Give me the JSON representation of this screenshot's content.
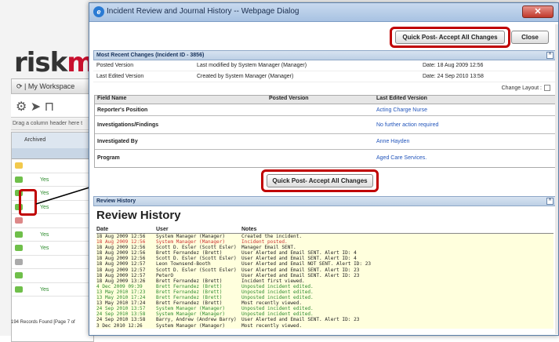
{
  "background_app": {
    "logo_text": "risk",
    "logo_text_accent": "ma",
    "nav_tab_label": "My Workspace",
    "drag_hint": "Drag a column header here t",
    "grid_header_label": "Archived",
    "row_values": [
      "",
      "Yes",
      "Yes",
      "Yes",
      "",
      "Yes",
      "Yes",
      "",
      "",
      "Yes"
    ],
    "records_found": "194 Records Found [Page 7 of"
  },
  "dialog": {
    "title": "Incident Review and Journal History -- Webpage Dialog",
    "quick_post_top_label": "Quick Post- Accept All Changes",
    "close_label": "Close",
    "recent_changes": {
      "section_title": "Most Recent Changes (Incident ID - 3856)",
      "versions": [
        {
          "label": "Posted Version",
          "modified": "Last modified by System Manager (Manager)",
          "date": "Date: 18 Aug 2009 12:56"
        },
        {
          "label": "Last Edited Version",
          "modified": "Created by System Manager (Manager)",
          "date": "Date: 24 Sep 2010 13:58"
        }
      ],
      "change_layout_label": "Change Layout :",
      "columns": [
        "Field Name",
        "Posted Version",
        "Last Edited Version"
      ],
      "fields": [
        {
          "name": "Reporter's Position",
          "posted": "",
          "edited": "Acting Charge Nurse"
        },
        {
          "name": "Investigations/Findings",
          "posted": "",
          "edited": "No further action required"
        },
        {
          "name": "Investigated By",
          "posted": "",
          "edited": "Anne Hayden"
        },
        {
          "name": "Program",
          "posted": "",
          "edited": "Aged Care Services."
        }
      ],
      "quick_post_middle_label": "Quick Post- Accept All Changes"
    },
    "review_history": {
      "section_title": "Review History",
      "heading": "Review History",
      "columns": [
        "Date",
        "User",
        "Notes"
      ],
      "entries": [
        {
          "date": "18 Aug 2009 12:56",
          "user": "System Manager (Manager)",
          "notes": "Created the incident.",
          "color": "#222222",
          "bg": "#ffffdd"
        },
        {
          "date": "18 Aug 2009 12:56",
          "user": "System Manager (Manager)",
          "notes": "Incident posted.",
          "color": "#cc3333",
          "bg": "#ffffdd"
        },
        {
          "date": "18 Aug 2009 12:56",
          "user": "Scott D. Esler (Scott Esler)",
          "notes": "Manager Email SENT.",
          "color": "#222222",
          "bg": "#ffffdd"
        },
        {
          "date": "18 Aug 2009 12:56",
          "user": "Brett Fernandez (Brett)",
          "notes": "User Alerted and Email SENT. Alert ID: 4",
          "color": "#222222",
          "bg": "#ffffdd"
        },
        {
          "date": "18 Aug 2009 12:56",
          "user": "Scott D. Esler (Scott Esler)",
          "notes": "User Alerted and Email SENT. Alert ID: 4",
          "color": "#222222",
          "bg": "#ffffdd"
        },
        {
          "date": "18 Aug 2009 12:57",
          "user": "Leon Townsend-Booth",
          "notes": "User Alerted and Email NOT SENT. Alert ID: 23",
          "color": "#222222",
          "bg": "#ffffdd"
        },
        {
          "date": "18 Aug 2009 12:57",
          "user": "Scott D. Esler (Scott Esler)",
          "notes": "User Alerted and Email SENT. Alert ID: 23",
          "color": "#222222",
          "bg": "#ffffdd"
        },
        {
          "date": "18 Aug 2009 12:57",
          "user": "PeterO",
          "notes": "User Alerted and Email SENT. Alert ID: 23",
          "color": "#222222",
          "bg": "#ffffdd"
        },
        {
          "date": "18 Aug 2009 13:26",
          "user": "Brett Fernandez (Brett)",
          "notes": "Incident first viewed.",
          "color": "#222222",
          "bg": "#ffffdd"
        },
        {
          "date": " 4 Dec 2009 09:39",
          "user": "Brett Fernandez (Brett)",
          "notes": "Unposted incident edited.",
          "color": "#2e8b2e",
          "bg": "#ffffdd"
        },
        {
          "date": "13 May 2010 17:23",
          "user": "Brett Fernandez (Brett)",
          "notes": "Unposted incident edited.",
          "color": "#2e8b2e",
          "bg": "#ffffdd"
        },
        {
          "date": "13 May 2010 17:24",
          "user": "Brett Fernandez (Brett)",
          "notes": "Unposted incident edited.",
          "color": "#2e8b2e",
          "bg": "#ffffdd"
        },
        {
          "date": "13 May 2010 17:24",
          "user": "Brett Fernandez (Brett)",
          "notes": "Most recently viewed.",
          "color": "#222222",
          "bg": "#ffffdd"
        },
        {
          "date": "24 Sep 2010 13:57",
          "user": "System Manager (Manager)",
          "notes": "Unposted incident edited.",
          "color": "#2e8b2e",
          "bg": "#ffffdd"
        },
        {
          "date": "24 Sep 2010 13:58",
          "user": "System Manager (Manager)",
          "notes": "Unposted incident edited.",
          "color": "#2e8b2e",
          "bg": "#ffffdd"
        },
        {
          "date": "24 Sep 2010 13:58",
          "user": "Barry, Andrew (Andrew Barry)",
          "notes": "User Alerted and Email SENT. Alert ID: 23",
          "color": "#222222",
          "bg": "#ffffdd"
        },
        {
          "date": " 3 Dec 2010 12:26",
          "user": "System Manager (Manager)",
          "notes": "Most recently viewed.",
          "color": "#222222",
          "bg": "#ffffdd"
        }
      ]
    }
  },
  "colors": {
    "highlight": "#c00000",
    "link": "#2255bb"
  }
}
